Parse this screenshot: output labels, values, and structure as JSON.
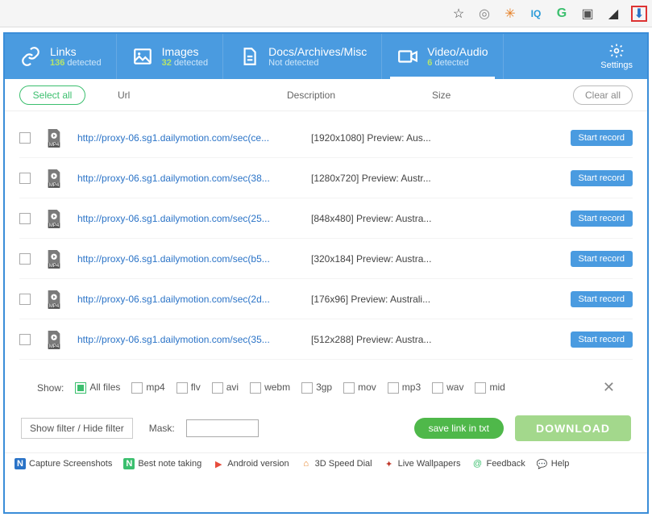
{
  "browser_icons": [
    "star",
    "target",
    "honeybee",
    "iq",
    "g",
    "cast",
    "paint",
    "download"
  ],
  "header": {
    "tabs": [
      {
        "id": "links",
        "title": "Links",
        "count": "136",
        "detected_word": "detected",
        "active": false
      },
      {
        "id": "images",
        "title": "Images",
        "count": "32",
        "detected_word": "detected",
        "active": false
      },
      {
        "id": "docs",
        "title": "Docs/Archives/Misc",
        "sub": "Not detected",
        "active": false
      },
      {
        "id": "video",
        "title": "Video/Audio",
        "count": "6",
        "detected_word": "detected",
        "active": true
      }
    ],
    "settings": "Settings"
  },
  "cols": {
    "select_all": "Select all",
    "url": "Url",
    "description": "Description",
    "size": "Size",
    "clear_all": "Clear all"
  },
  "rows": [
    {
      "url": "http://proxy-06.sg1.dailymotion.com/sec(ce...",
      "desc": "[1920x1080] Preview: Aus...",
      "btn": "Start record"
    },
    {
      "url": "http://proxy-06.sg1.dailymotion.com/sec(38...",
      "desc": "[1280x720] Preview: Austr...",
      "btn": "Start record"
    },
    {
      "url": "http://proxy-06.sg1.dailymotion.com/sec(25...",
      "desc": "[848x480] Preview: Austra...",
      "btn": "Start record"
    },
    {
      "url": "http://proxy-06.sg1.dailymotion.com/sec(b5...",
      "desc": "[320x184] Preview: Austra...",
      "btn": "Start record"
    },
    {
      "url": "http://proxy-06.sg1.dailymotion.com/sec(2d...",
      "desc": "[176x96] Preview: Australi...",
      "btn": "Start record"
    },
    {
      "url": "http://proxy-06.sg1.dailymotion.com/sec(35...",
      "desc": "[512x288] Preview: Austra...",
      "btn": "Start record"
    }
  ],
  "file_badge": "MP4",
  "filter": {
    "show_label": "Show:",
    "options": [
      "All files",
      "mp4",
      "flv",
      "avi",
      "webm",
      "3gp",
      "mov",
      "mp3",
      "wav",
      "mid"
    ],
    "selected_index": 0
  },
  "actions": {
    "filter_toggle": "Show filter / Hide filter",
    "mask_label": "Mask:",
    "mask_value": "",
    "save_txt": "save link in txt",
    "download": "DOWNLOAD"
  },
  "bottom_links": [
    {
      "icon": "n-box",
      "label": "Capture Screenshots",
      "color": "#2a73c7"
    },
    {
      "icon": "n-box-green",
      "label": "Best note taking",
      "color": "#3bbf6e"
    },
    {
      "icon": "play",
      "label": "Android version",
      "color": "#e74c3c"
    },
    {
      "icon": "house",
      "label": "3D Speed Dial",
      "color": "#e67e22"
    },
    {
      "icon": "star",
      "label": "Live Wallpapers",
      "color": "#c0392b"
    },
    {
      "icon": "at",
      "label": "Feedback",
      "color": "#3bbf6e"
    },
    {
      "icon": "chat",
      "label": "Help",
      "color": "#2a73c7"
    }
  ]
}
